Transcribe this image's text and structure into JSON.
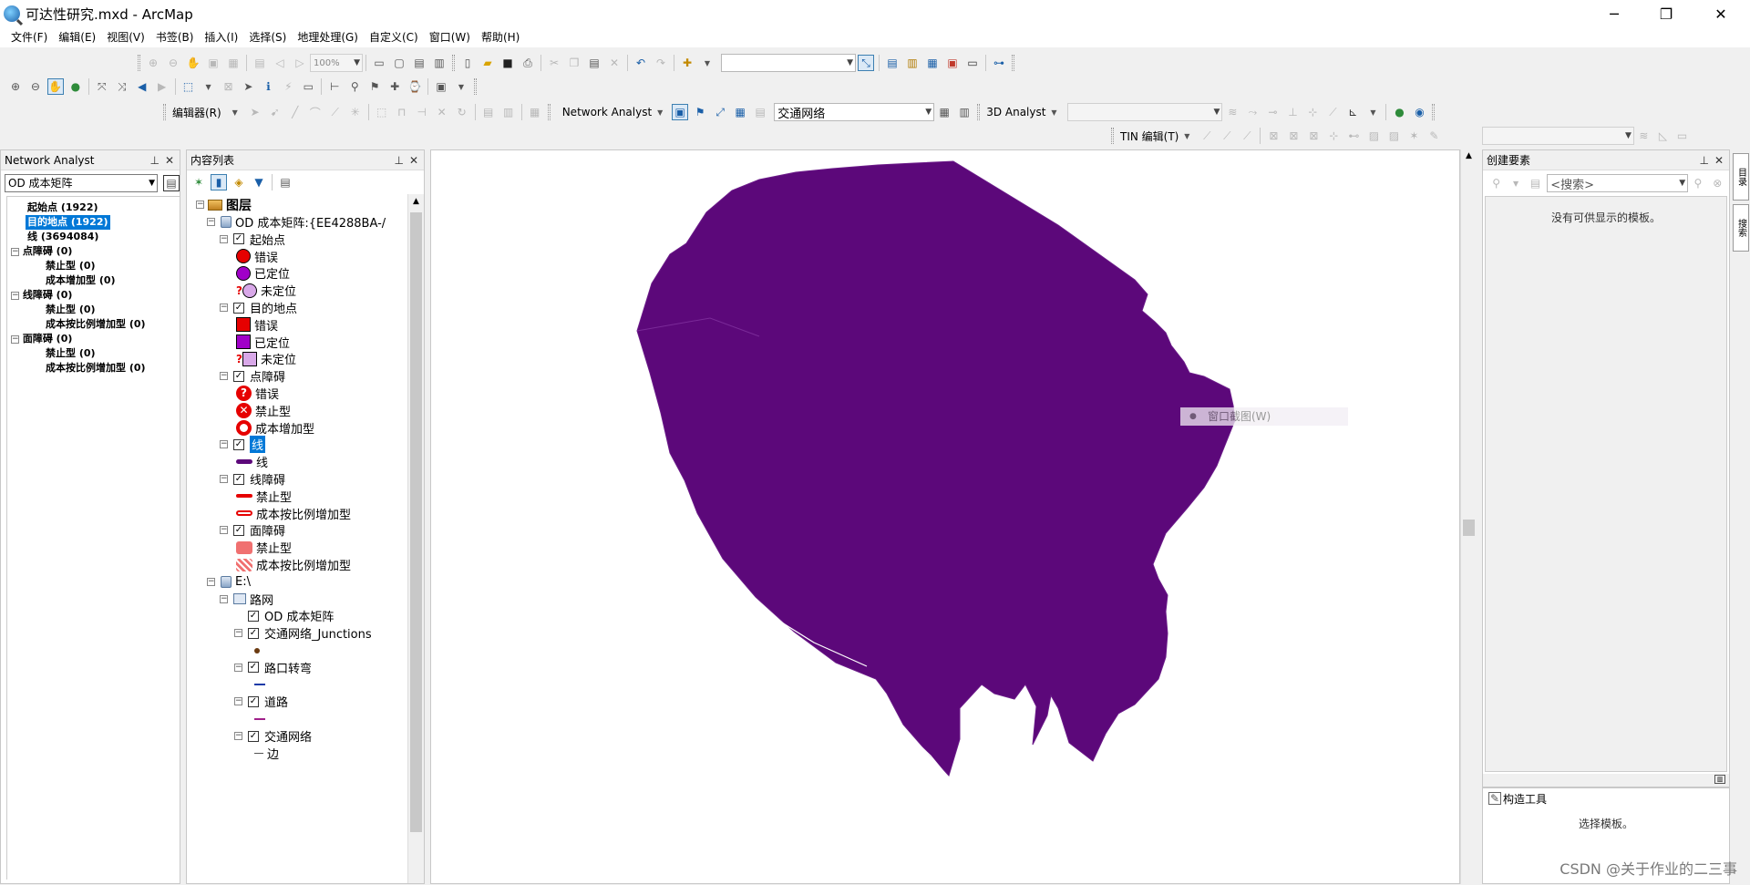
{
  "title": "可达性研究.mxd - ArcMap",
  "window_controls": {
    "minimize": "─",
    "restore": "❐",
    "close": "✕"
  },
  "menu": [
    "文件(F)",
    "编辑(E)",
    "视图(V)",
    "书签(B)",
    "插入(I)",
    "选择(S)",
    "地理处理(G)",
    "自定义(C)",
    "窗口(W)",
    "帮助(H)"
  ],
  "toolbar": {
    "zoom": "100%",
    "editor": "编辑器(R)",
    "network_analyst": "Network Analyst",
    "network_dataset": "交通网络",
    "analyst_3d": "3D Analyst",
    "tin_editor": "TIN 编辑(T)"
  },
  "na_window": {
    "title": "Network Analyst",
    "layer": "OD 成本矩阵",
    "items": [
      {
        "label": "起始点 (1922)"
      },
      {
        "label": "目的地点 (1922)",
        "selected": true
      },
      {
        "label": "线 (3694084)"
      },
      {
        "label": "点障碍 (0)",
        "expandable": true
      },
      {
        "label": "禁止型 (0)"
      },
      {
        "label": "成本增加型 (0)"
      },
      {
        "label": "线障碍 (0)",
        "expandable": true
      },
      {
        "label": "禁止型 (0)"
      },
      {
        "label": "成本按比例增加型 (0)"
      },
      {
        "label": "面障碍 (0)",
        "expandable": true
      },
      {
        "label": "禁止型 (0)"
      },
      {
        "label": "成本按比例增加型 (0)"
      }
    ]
  },
  "toc": {
    "title": "内容列表",
    "root": "图层",
    "rows": [
      {
        "label": "OD 成本矩阵:{EE4288BA-/",
        "kind": "group"
      },
      {
        "label": "起始点",
        "kind": "layer"
      },
      {
        "label": "错误",
        "kind": "sym",
        "sym": "circle-red"
      },
      {
        "label": "已定位",
        "kind": "sym",
        "sym": "circle-purple"
      },
      {
        "label": "未定位",
        "kind": "sym",
        "sym": "circle-unlocated"
      },
      {
        "label": "目的地点",
        "kind": "layer"
      },
      {
        "label": "错误",
        "kind": "sym",
        "sym": "square-red"
      },
      {
        "label": "已定位",
        "kind": "sym",
        "sym": "square-purple"
      },
      {
        "label": "未定位",
        "kind": "sym",
        "sym": "square-unlocated"
      },
      {
        "label": "点障碍",
        "kind": "layer"
      },
      {
        "label": "错误",
        "kind": "sym",
        "sym": "barrier-error"
      },
      {
        "label": "禁止型",
        "kind": "sym",
        "sym": "barrier-restrict"
      },
      {
        "label": "成本增加型",
        "kind": "sym",
        "sym": "barrier-cost"
      },
      {
        "label": "线",
        "kind": "layer",
        "selected": true
      },
      {
        "label": "线",
        "kind": "sym",
        "sym": "line-purple"
      },
      {
        "label": "线障碍",
        "kind": "layer"
      },
      {
        "label": "禁止型",
        "kind": "sym",
        "sym": "line-red"
      },
      {
        "label": "成本按比例增加型",
        "kind": "sym",
        "sym": "line-red-hollow"
      },
      {
        "label": "面障碍",
        "kind": "layer"
      },
      {
        "label": "禁止型",
        "kind": "sym",
        "sym": "poly-red"
      },
      {
        "label": "成本按比例增加型",
        "kind": "sym",
        "sym": "poly-red-hatch"
      },
      {
        "label": "E:\\",
        "kind": "group"
      },
      {
        "label": "路网",
        "kind": "subgroup"
      },
      {
        "label": "OD 成本矩阵",
        "kind": "sublayer"
      },
      {
        "label": "交通网络_Junctions",
        "kind": "sublayer-exp"
      },
      {
        "label": "",
        "kind": "subsym",
        "sym": "dot-brown"
      },
      {
        "label": "路口转弯",
        "kind": "sublayer-exp"
      },
      {
        "label": "",
        "kind": "subsym",
        "sym": "line-blue"
      },
      {
        "label": "道路",
        "kind": "sublayer-exp"
      },
      {
        "label": "",
        "kind": "subsym",
        "sym": "line-magenta"
      },
      {
        "label": "交通网络",
        "kind": "sublayer-exp"
      },
      {
        "label": "边",
        "kind": "subsym",
        "sym": "line-gray"
      }
    ]
  },
  "map": {
    "fill_color": "#5c087a",
    "stroke_color": "#6a1a88"
  },
  "context_menu": {
    "item": "窗口截图(W)"
  },
  "create_features": {
    "title": "创建要素",
    "search_placeholder": "<搜索>",
    "empty_text": "没有可供显示的模板。"
  },
  "construct_tools": {
    "title": "构造工具",
    "text": "选择模板。"
  },
  "side_tabs": [
    "目录",
    "搜索"
  ],
  "watermark": "CSDN @关于作业的二三事",
  "colors": {
    "selection": "#0078d7",
    "accent_purple": "#5c087a"
  }
}
